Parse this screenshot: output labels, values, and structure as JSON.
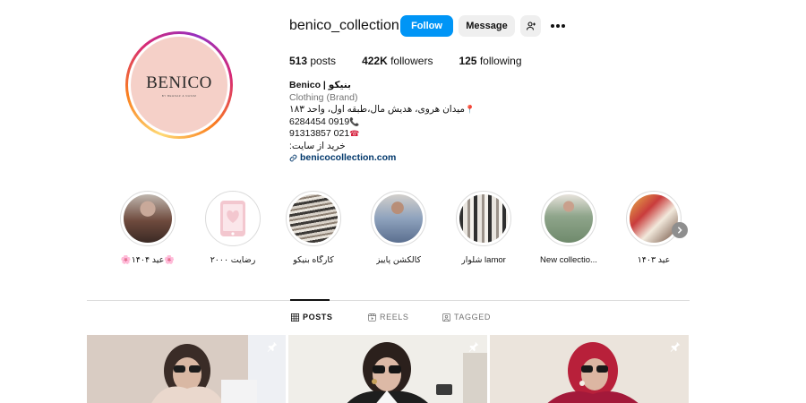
{
  "profile": {
    "username": "benico_collection",
    "logo_text": "BENICO",
    "logo_sub": "BY BEHNAZ & NASIM"
  },
  "actions": {
    "follow": "Follow",
    "message": "Message"
  },
  "stats": {
    "posts_count": "513",
    "posts_label": "posts",
    "followers_count": "422K",
    "followers_label": "followers",
    "following_count": "125",
    "following_label": "following"
  },
  "bio": {
    "name": "Benico | بنیکو",
    "category": "Clothing (Brand)",
    "address": "میدان هروی، هدیش مال،طبقه اول، واحد ۱۸۳",
    "phone1": "6284454 0919",
    "phone2": "91313857 021",
    "shop_line": "خرید از سایت:",
    "link": "benicocollection.com"
  },
  "highlights": [
    {
      "label": "🌸عید ۱۴۰۴🌸",
      "icon": "photo"
    },
    {
      "label": "۲۰۰۰ رضایت",
      "icon": "phone-heart"
    },
    {
      "label": "کارگاه بنیکو",
      "icon": "photo"
    },
    {
      "label": "کالکشن پاییز",
      "icon": "photo"
    },
    {
      "label": "شلوار lamor",
      "icon": "photo"
    },
    {
      "label": "New collectio...",
      "icon": "photo"
    },
    {
      "label": "عید ۱۴۰۳",
      "icon": "photo"
    }
  ],
  "tabs": {
    "posts": "POSTS",
    "reels": "REELS",
    "tagged": "TAGGED"
  },
  "colors": {
    "follow_button": "#0095f6",
    "secondary_button": "#efefef",
    "link": "#00376b",
    "avatar_bg": "#f5d0c8"
  }
}
